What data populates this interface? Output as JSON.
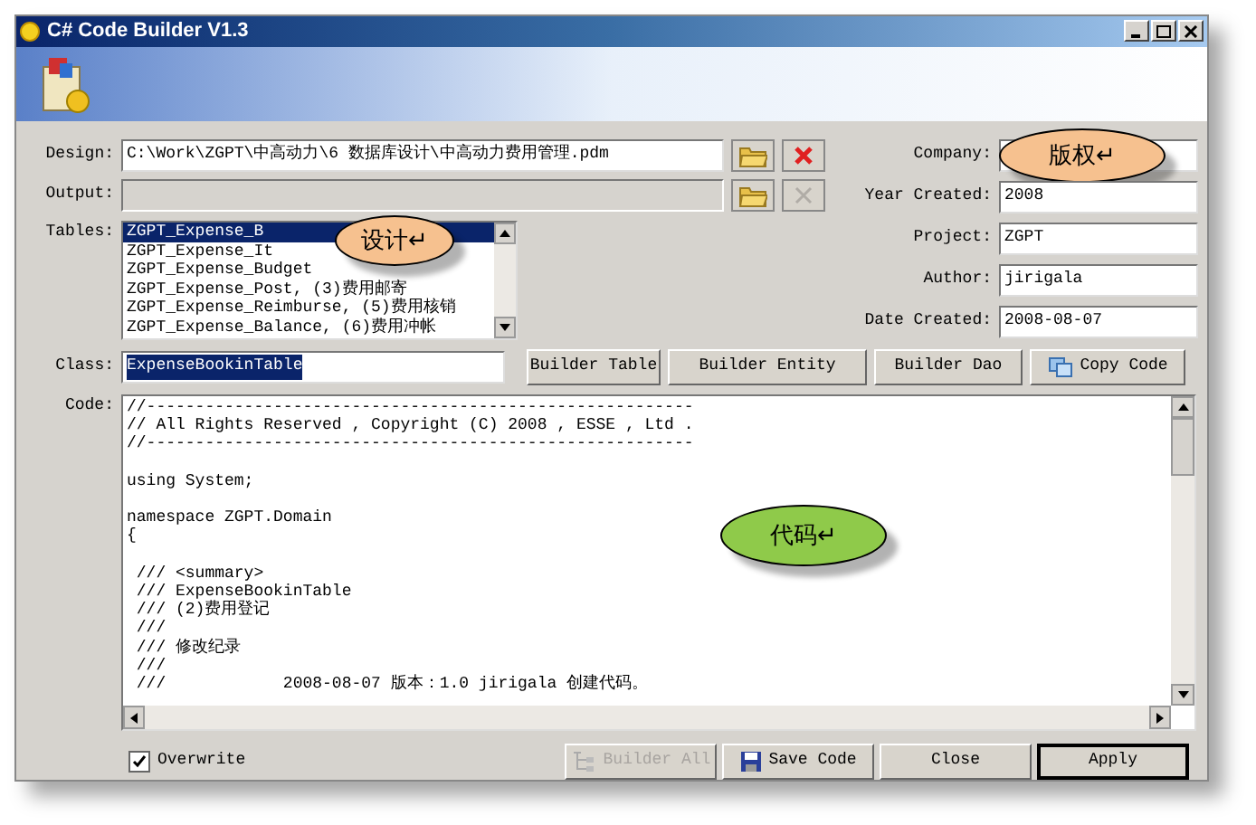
{
  "window": {
    "title": "C# Code Builder V1.3"
  },
  "design": {
    "label": "Design:",
    "value": "C:\\Work\\ZGPT\\中高动力\\6 数据库设计\\中高动力费用管理.pdm",
    "clear_disabled": false
  },
  "output": {
    "label": "Output:",
    "clear_disabled": true
  },
  "tables": {
    "label": "Tables:",
    "items": [
      {
        "text": "ZGPT_Expense_B",
        "selected": true
      },
      {
        "text": "ZGPT_Expense_It",
        "selected": false
      },
      {
        "text": "ZGPT_Expense_Budget",
        "selected": false
      },
      {
        "text": "ZGPT_Expense_Post, (3)费用邮寄",
        "selected": false
      },
      {
        "text": "ZGPT_Expense_Reimburse, (5)费用核销",
        "selected": false
      },
      {
        "text": "ZGPT_Expense_Balance, (6)费用冲帐",
        "selected": false
      }
    ]
  },
  "class": {
    "label": "Class:",
    "value": "ExpenseBookinTable"
  },
  "info": [
    {
      "label": "Company:"
    },
    {
      "label": "Year Created:",
      "value": "2008"
    },
    {
      "label": "Project:",
      "value": "ZGPT"
    },
    {
      "label": "Author:",
      "value": "jirigala"
    },
    {
      "label": "Date Created:",
      "value": "2008-08-07"
    }
  ],
  "builder_buttons": [
    {
      "label": "Builder Table",
      "kind": "plain"
    },
    {
      "label": "Builder Entity",
      "kind": "plain"
    },
    {
      "label": "Builder Dao",
      "kind": "plain"
    },
    {
      "label": "Copy Code",
      "kind": "copy"
    }
  ],
  "code": {
    "label": "Code:",
    "text": "//--------------------------------------------------------\n// All Rights Reserved , Copyright (C) 2008 , ESSE , Ltd .\n//--------------------------------------------------------\n\nusing System;\n\nnamespace ZGPT.Domain\n{\n\n /// <summary>\n /// ExpenseBookinTable\n /// (2)费用登记\n ///\n /// 修改纪录\n ///\n ///            2008-08-07 版本：1.0 jirigala 创建代码。"
  },
  "overwrite": {
    "label": "Overwrite",
    "checked": true
  },
  "bottom_buttons": [
    {
      "label": "Builder All",
      "kind": "tree",
      "disabled": true
    },
    {
      "label": "Save Code",
      "kind": "save",
      "disabled": false
    },
    {
      "label": "Close",
      "kind": "plain",
      "disabled": false
    },
    {
      "label": "Apply",
      "kind": "default",
      "disabled": false
    }
  ],
  "callouts": [
    {
      "text": "设计↵",
      "color": "#f6c18f"
    },
    {
      "text": "版权↵",
      "color": "#f6c18f"
    },
    {
      "text": "代码↵",
      "color": "#8fca4a"
    }
  ]
}
